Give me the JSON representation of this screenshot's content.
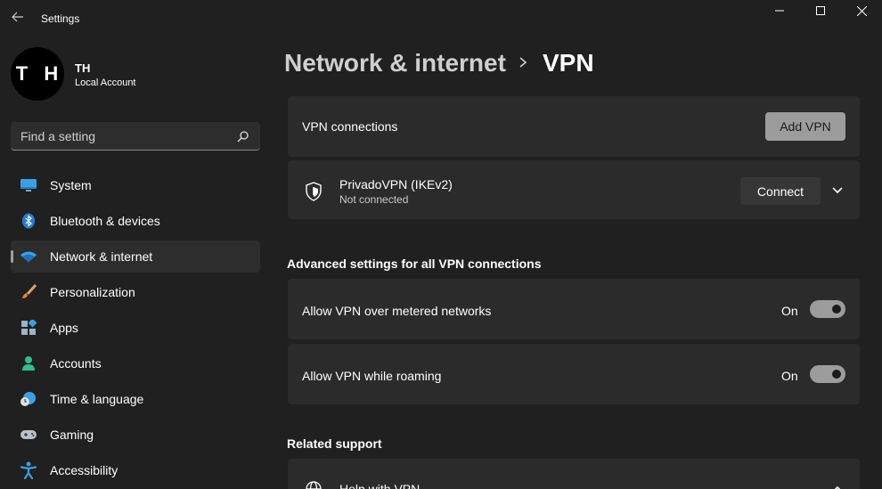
{
  "window": {
    "title": "Settings"
  },
  "profile": {
    "initials": "T H",
    "name": "TH",
    "account_type": "Local Account"
  },
  "search": {
    "placeholder": "Find a setting"
  },
  "sidebar": {
    "items": [
      {
        "label": "System",
        "icon": "system-monitor-icon",
        "active": false
      },
      {
        "label": "Bluetooth & devices",
        "icon": "bluetooth-icon",
        "active": false
      },
      {
        "label": "Network & internet",
        "icon": "wifi-icon",
        "active": true
      },
      {
        "label": "Personalization",
        "icon": "brush-icon",
        "active": false
      },
      {
        "label": "Apps",
        "icon": "apps-icon",
        "active": false
      },
      {
        "label": "Accounts",
        "icon": "person-icon",
        "active": false
      },
      {
        "label": "Time & language",
        "icon": "globe-clock-icon",
        "active": false
      },
      {
        "label": "Gaming",
        "icon": "gamepad-icon",
        "active": false
      },
      {
        "label": "Accessibility",
        "icon": "accessibility-icon",
        "active": false
      }
    ]
  },
  "breadcrumb": {
    "parent": "Network & internet",
    "current": "VPN"
  },
  "vpn_connections": {
    "label": "VPN connections",
    "add_button": "Add VPN"
  },
  "vpn_entry": {
    "name": "PrivadoVPN (IKEv2)",
    "status": "Not connected",
    "connect_button": "Connect"
  },
  "advanced": {
    "title": "Advanced settings for all VPN connections",
    "settings": [
      {
        "label": "Allow VPN over metered networks",
        "state": "On",
        "on": true
      },
      {
        "label": "Allow VPN while roaming",
        "state": "On",
        "on": true
      }
    ]
  },
  "related": {
    "title": "Related support",
    "item": "Help with VPN"
  },
  "colors": {
    "background": "#202020",
    "card": "#2b2b2b",
    "accent_blue": "#0078d4",
    "toggle": "#9c9c9c"
  }
}
